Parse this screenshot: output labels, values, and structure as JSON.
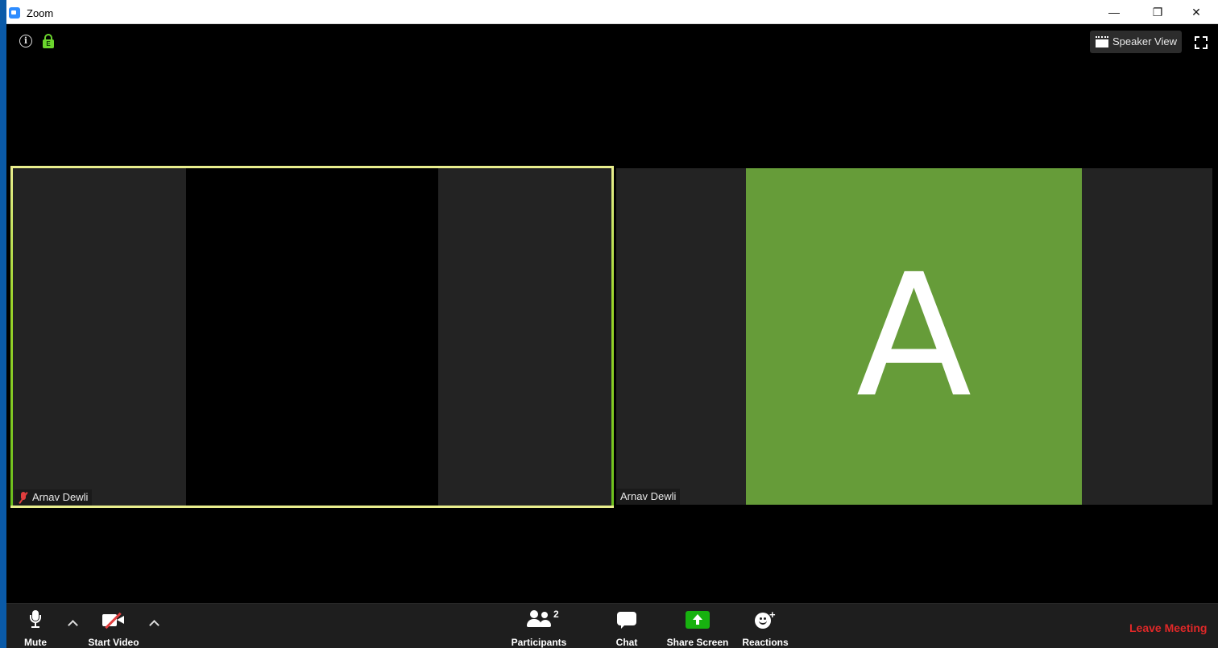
{
  "window": {
    "title": "Zoom",
    "minimize_glyph": "—",
    "restore_glyph": "❐",
    "close_glyph": "✕"
  },
  "top_bar": {
    "info_glyph": "i",
    "encryption_badge": "E",
    "speaker_view_label": "Speaker View"
  },
  "tiles": [
    {
      "name": "Arnav Dewli",
      "muted": true,
      "active_speaker": true,
      "video_on": true
    },
    {
      "name": "Arnav Dewli",
      "avatar_letter": "A",
      "avatar_color": "#669c39",
      "muted": false,
      "video_on": false
    }
  ],
  "toolbar": {
    "mute_label": "Mute",
    "start_video_label": "Start Video",
    "participants_label": "Participants",
    "participants_count": "2",
    "chat_label": "Chat",
    "share_screen_label": "Share Screen",
    "reactions_label": "Reactions",
    "leave_label": "Leave Meeting"
  },
  "colors": {
    "active_speaker_border": "#e9ee8d",
    "share_green": "#17b10f",
    "leave_red": "#e02828",
    "titlebar_blue": "#0a5aa8"
  }
}
